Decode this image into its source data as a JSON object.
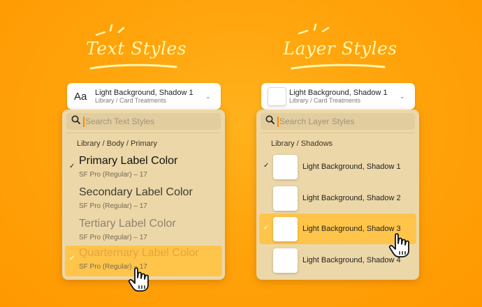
{
  "colors": {
    "background": "#ffa40c",
    "heading": "#fff7b0",
    "panel": "#ecd7a8",
    "selected_row": "#ffc54a",
    "search_caret": "#ff8a00"
  },
  "text_styles": {
    "heading": "Text Styles",
    "selector": {
      "icon": "Aa",
      "title": "Light Background, Shadow 1",
      "subtitle": "Library / Card Treatments"
    },
    "search_placeholder": "Search Text Styles",
    "group_label": "Library / Body / Primary",
    "items": [
      {
        "name": "Primary Label Color",
        "meta": "SF Pro (Regular) – 17",
        "checked": true,
        "color": "#111111"
      },
      {
        "name": "Secondary Label Color",
        "meta": "SF Pro (Regular) – 17",
        "checked": false,
        "color": "#3f3a30"
      },
      {
        "name": "Tertiary Label Color",
        "meta": "SF Pro (Regular) – 17",
        "checked": false,
        "color": "#8d8372"
      },
      {
        "name": "Quarternary Label Color",
        "meta": "SF Pro (Regular) – 17",
        "checked": false,
        "selected": true,
        "color": "#e8a23e"
      }
    ]
  },
  "layer_styles": {
    "heading": "Layer Styles",
    "selector": {
      "title": "Light Background, Shadow 1",
      "subtitle": "Library / Card Treatments"
    },
    "search_placeholder": "Search Layer Styles",
    "group_label": "Library / Shadows",
    "items": [
      {
        "name": "Light Background, Shadow 1",
        "checked": true
      },
      {
        "name": "Light Background, Shadow 2",
        "checked": false
      },
      {
        "name": "Light Background, Shadow 3",
        "checked": false,
        "selected": true
      },
      {
        "name": "Light Background, Shadow 4",
        "checked": false
      }
    ]
  },
  "icons": {
    "search": "search-icon",
    "check": "✓",
    "chevron": "⌄",
    "cursor": "pointing-hand-cursor-icon"
  }
}
